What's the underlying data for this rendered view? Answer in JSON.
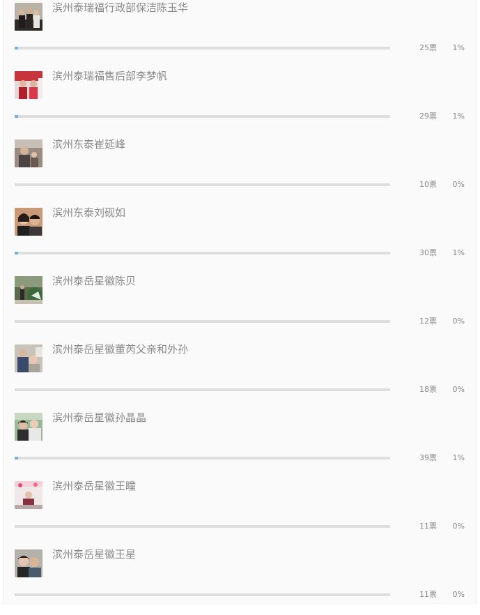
{
  "candidates": [
    {
      "name": "滨州泰瑞福行政部保洁陈玉华",
      "votes": "25票",
      "percent": "1%",
      "fill": 0.01
    },
    {
      "name": "滨州泰瑞福售后部李梦帆",
      "votes": "29票",
      "percent": "1%",
      "fill": 0.01
    },
    {
      "name": "滨州东泰崔延峰",
      "votes": "10票",
      "percent": "0%",
      "fill": 0
    },
    {
      "name": "滨州东泰刘砚如",
      "votes": "30票",
      "percent": "1%",
      "fill": 0.01
    },
    {
      "name": "滨州泰岳星徽陈贝",
      "votes": "12票",
      "percent": "0%",
      "fill": 0
    },
    {
      "name": "滨州泰岳星徽董芮父亲和外孙",
      "votes": "18票",
      "percent": "0%",
      "fill": 0
    },
    {
      "name": "滨州泰岳星徽孙晶晶",
      "votes": "39票",
      "percent": "1%",
      "fill": 0.01
    },
    {
      "name": "滨州泰岳星徽王瞳",
      "votes": "11票",
      "percent": "0%",
      "fill": 0
    },
    {
      "name": "滨州泰岳星徽王星",
      "votes": "11票",
      "percent": "0%",
      "fill": 0
    }
  ],
  "colors": {
    "bar_fill": "#7fb0dc",
    "bar_track": "#dedede",
    "text": "#8a8a8a"
  },
  "icons": {
    "thumbnail": "candidate-photo"
  }
}
